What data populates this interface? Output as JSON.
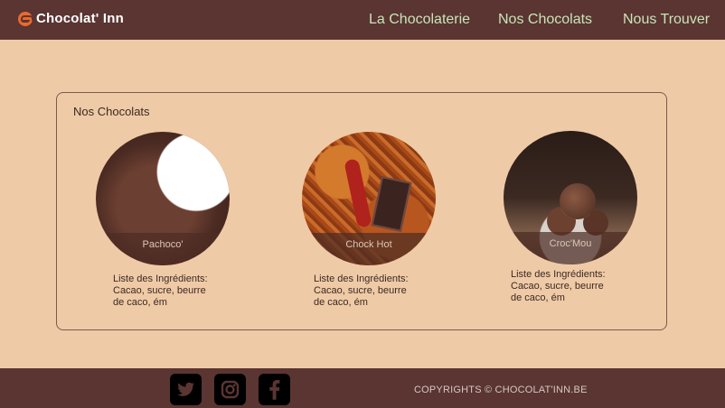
{
  "header": {
    "brand": "Chocolat' Inn",
    "nav": [
      "La Chocolaterie",
      "Nos Chocolats",
      "Nous Trouver"
    ]
  },
  "section": {
    "title": "Nos Chocolats",
    "products": [
      {
        "name": "Pachoco'",
        "ingredients_lines": [
          "Liste des Ingrédients:",
          "Cacao, sucre, beurre",
          "de caco, ém"
        ]
      },
      {
        "name": "Chock Hot",
        "ingredients_lines": [
          "Liste des Ingrédients:",
          "Cacao, sucre, beurre",
          "de caco, ém"
        ]
      },
      {
        "name": "Croc'Mou",
        "ingredients_lines": [
          "Liste des Ingrédients:",
          "Cacao, sucre, beurre",
          "de caco, ém"
        ]
      }
    ]
  },
  "footer": {
    "social_icons": [
      "twitter-icon",
      "instagram-icon",
      "facebook-icon"
    ],
    "copyright": "COPYRIGHTS © CHOCOLAT'INN.BE"
  },
  "colors": {
    "header_bg": "#5a3532",
    "page_bg": "#efcaa6",
    "nav_text": "#c9e4b7",
    "logo_accent": "#ea6a2e"
  }
}
